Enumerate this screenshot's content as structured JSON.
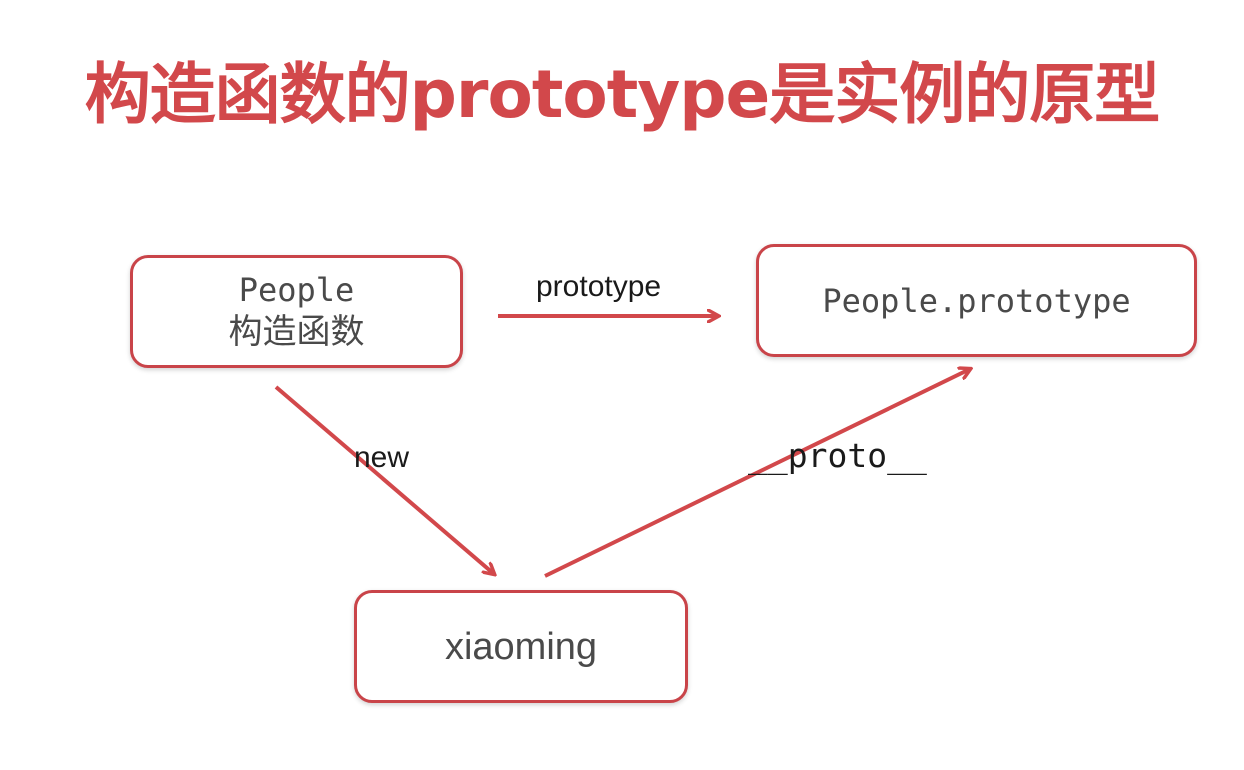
{
  "title": "构造函数的prototype是实例的原型",
  "nodes": {
    "people": {
      "line1": "People",
      "line2": "构造函数"
    },
    "people_prototype": {
      "label": "People.prototype"
    },
    "xiaoming": {
      "label": "xiaoming"
    }
  },
  "edges": {
    "prototype": "prototype",
    "new": "new",
    "proto": "__proto__"
  },
  "colors": {
    "accent": "#d2484b",
    "border": "#c94449",
    "text": "#4a4a4a"
  }
}
